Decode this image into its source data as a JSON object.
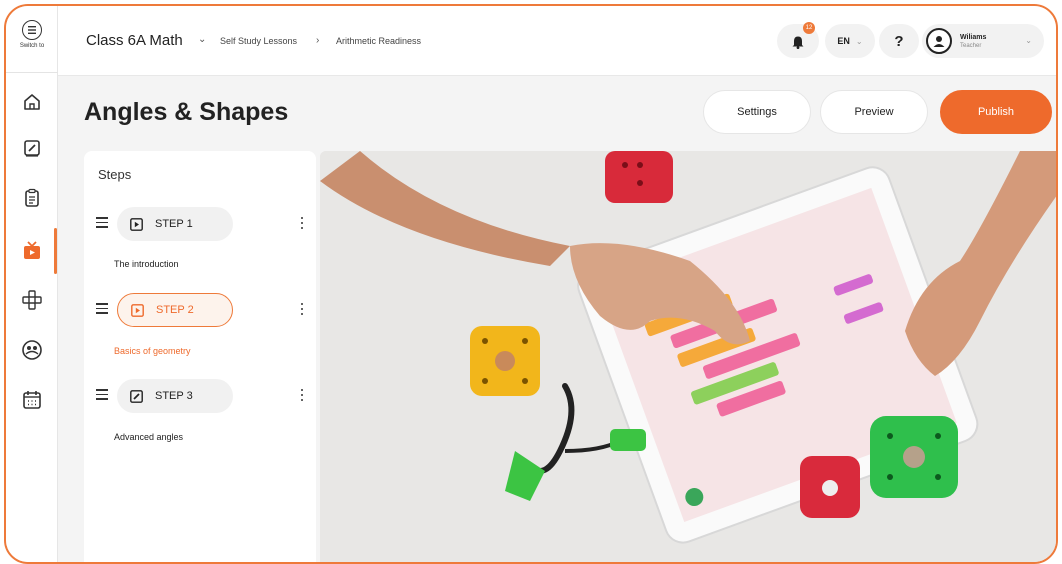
{
  "rail": {
    "switch_label": "Switch to",
    "icons": [
      "home-icon",
      "edit-icon",
      "document-icon",
      "tv-icon",
      "modules-icon",
      "community-icon",
      "calendar-icon"
    ]
  },
  "topbar": {
    "course_title": "Class 6A Math",
    "breadcrumb": [
      "Self Study Lessons",
      "Arithmetic Readiness"
    ],
    "notification_count": "12",
    "language": "EN",
    "help": "?",
    "user_name": "Wiliams",
    "user_role": "Teacher"
  },
  "page": {
    "title": "Angles & Shapes",
    "buttons": {
      "settings": "Settings",
      "preview": "Preview",
      "publish": "Publish"
    }
  },
  "steps": {
    "title": "Steps",
    "items": [
      {
        "label": "STEP 1",
        "description": "The introduction",
        "type": "video",
        "active": false
      },
      {
        "label": "STEP 2",
        "description": "Basics of geometry",
        "type": "video",
        "active": true
      },
      {
        "label": "STEP 3",
        "description": "Advanced angles",
        "type": "edit",
        "active": false
      }
    ]
  },
  "colors": {
    "accent": "#ee6a2c",
    "border": "#ee7a3a"
  }
}
